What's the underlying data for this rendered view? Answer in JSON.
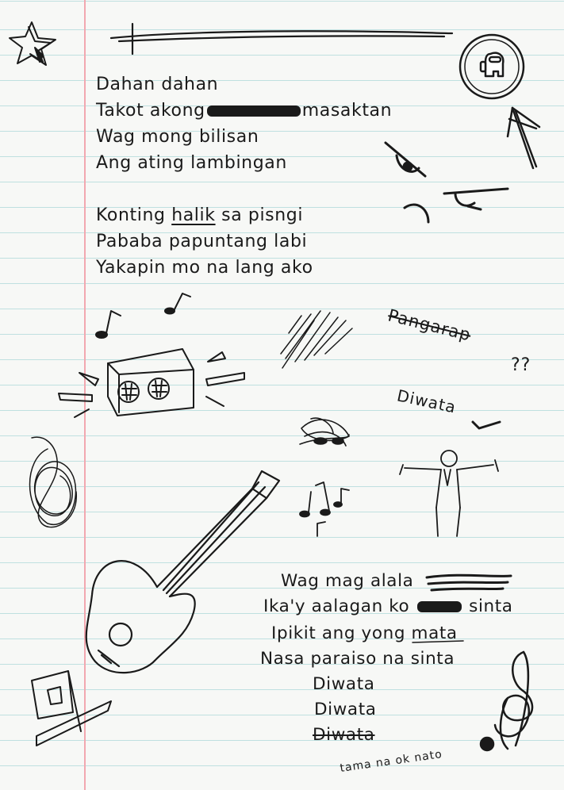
{
  "lyrics_top": [
    "Dahan dahan",
    "Takot akong",
    "masaktan",
    "Wag mong bilisan",
    "Ang ating lambingan"
  ],
  "lyrics_second": {
    "line1_a": "Konting",
    "line1_b": "halik",
    "line1_c": "sa pisngi",
    "line2": "Pababa papuntang labi",
    "line3": "Yakapin mo na lang ako"
  },
  "side_words": {
    "pangarap": "Pangarap",
    "question": "??",
    "diwata": "Diwata"
  },
  "lyrics_bottom": {
    "line1": "Wag mag alala",
    "line2_a": "Ika'y aalagan ko",
    "line2_b": "sinta",
    "line3_a": "Ipikit ang yong",
    "line3_b": "mata",
    "line4": "Nasa paraiso na sinta",
    "line5": "Diwata",
    "line6": "Diwata",
    "line7": "Diwata"
  },
  "note": "tama na ok nato",
  "colors": {
    "ink": "#1a1a1a",
    "paper": "#f7f8f6",
    "rule": "#bfe0e0",
    "margin": "#f2a8b0"
  },
  "icons": [
    "star-icon",
    "crewmate-icon",
    "arrow-icon",
    "eye-icon",
    "music-note-icon",
    "speaker-icon",
    "guitar-icon",
    "treble-clef-icon",
    "stick-figure-icon",
    "checkmark-icon"
  ]
}
